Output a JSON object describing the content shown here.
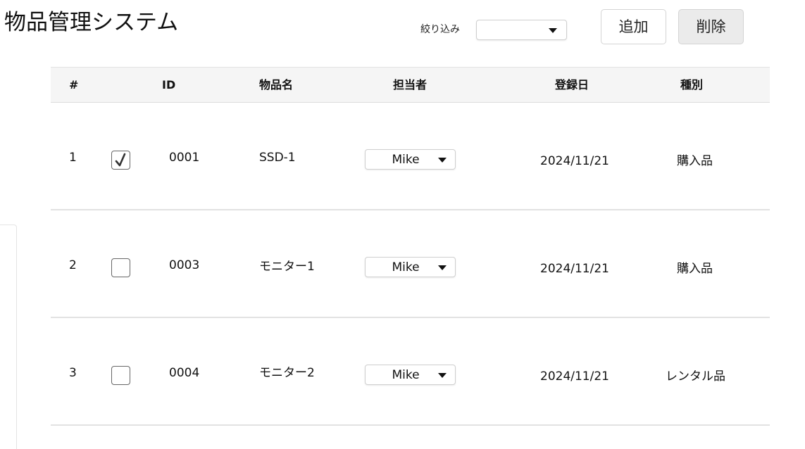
{
  "header": {
    "title": "物品管理システム",
    "filter_label": "絞り込み",
    "filter_value": "",
    "add_label": "追加",
    "delete_label": "削除"
  },
  "table": {
    "columns": {
      "num": "#",
      "id": "ID",
      "name": "物品名",
      "owner": "担当者",
      "date": "登録日",
      "type": "種別"
    },
    "rows": [
      {
        "num": "1",
        "checked": true,
        "id": "0001",
        "name": "SSD-1",
        "owner": "Mike",
        "date": "2024/11/21",
        "type": "購入品"
      },
      {
        "num": "2",
        "checked": false,
        "id": "0003",
        "name": "モニター1",
        "owner": "Mike",
        "date": "2024/11/21",
        "type": "購入品"
      },
      {
        "num": "3",
        "checked": false,
        "id": "0004",
        "name": "モニター2",
        "owner": "Mike",
        "date": "2024/11/21",
        "type": "レンタル品"
      }
    ]
  }
}
